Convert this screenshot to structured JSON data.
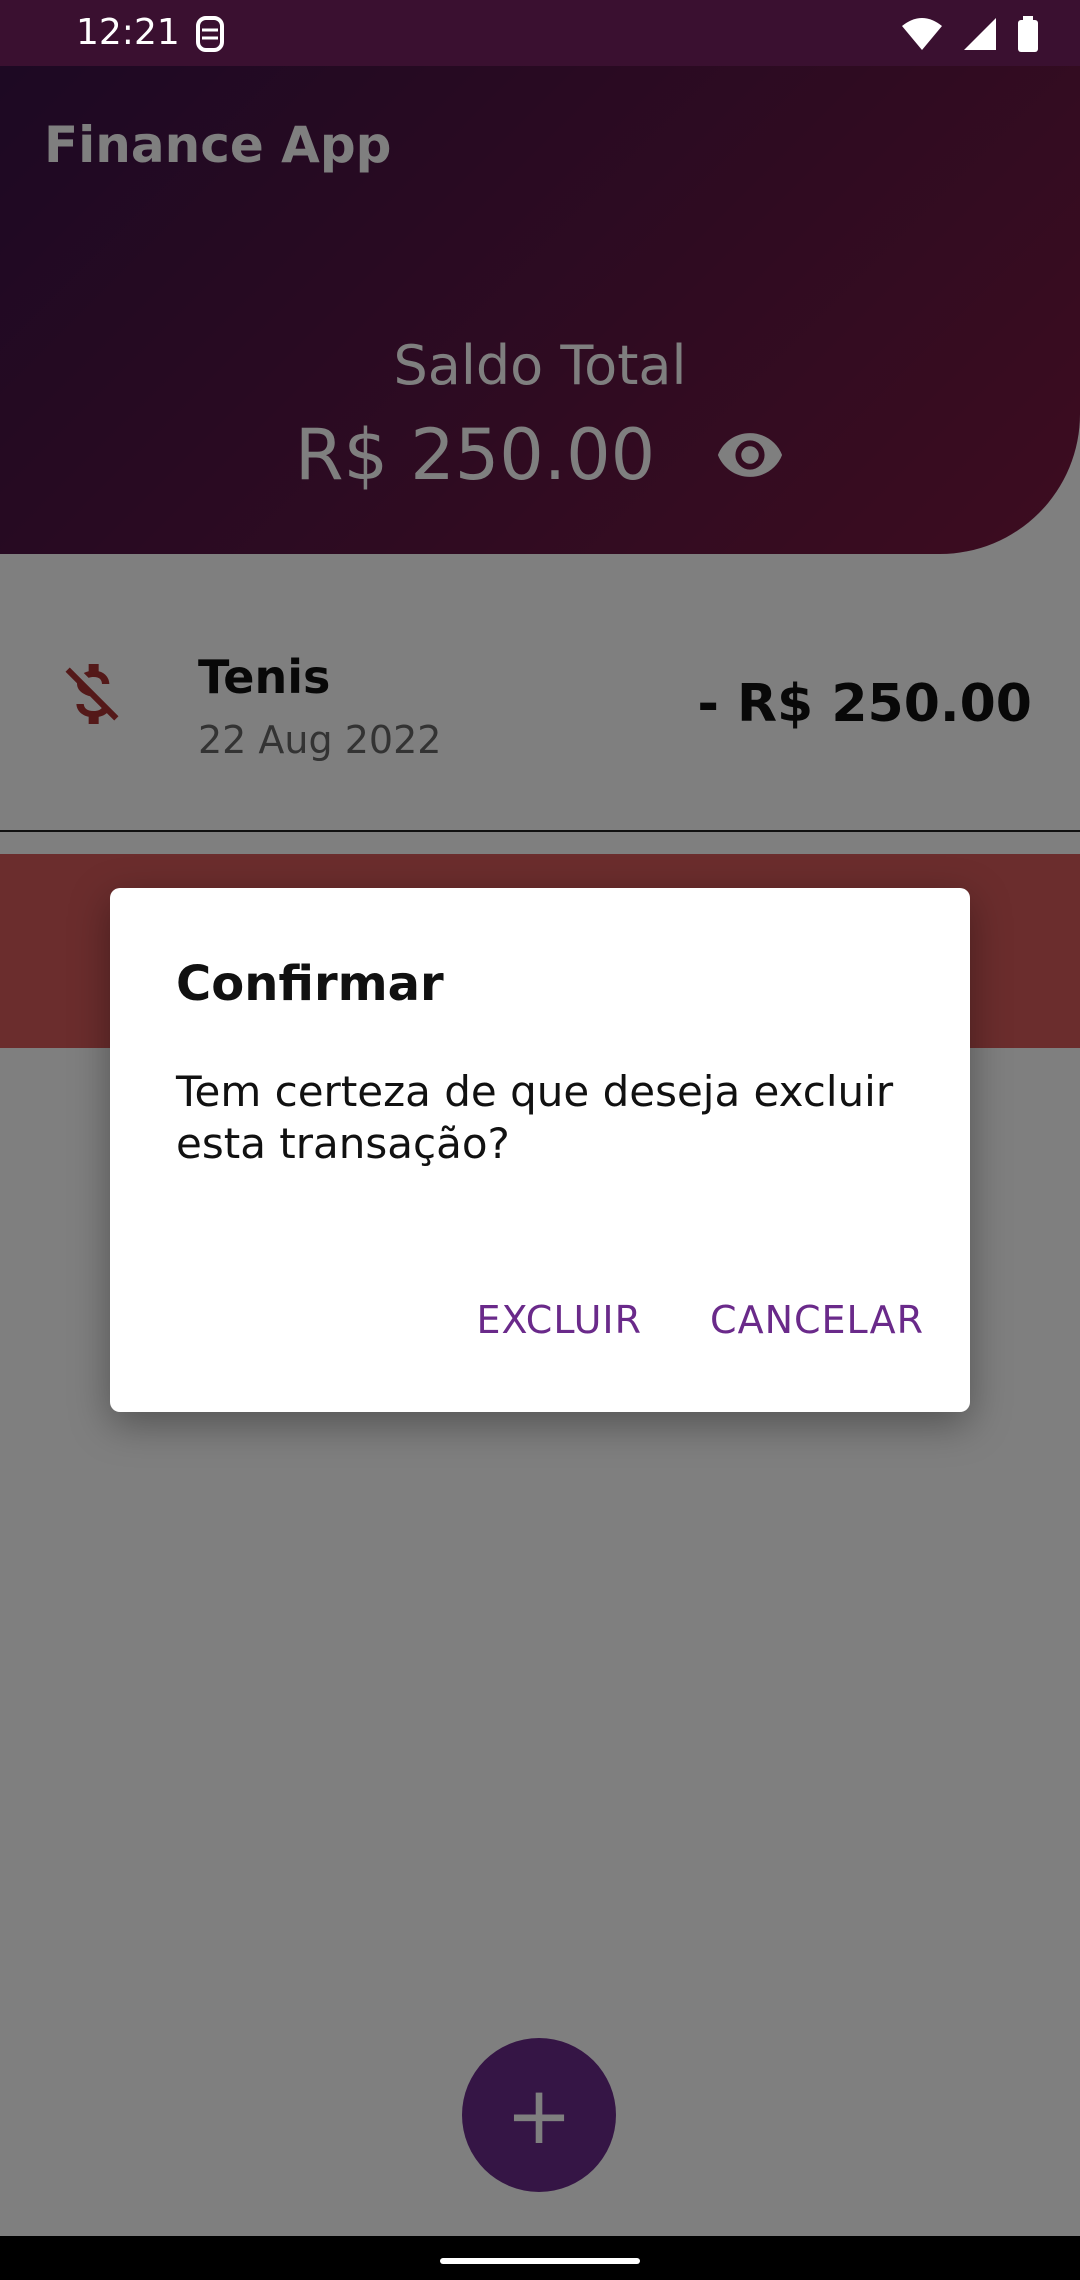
{
  "status_bar": {
    "time": "12:21"
  },
  "header": {
    "app_title": "Finance App",
    "balance_label": "Saldo Total",
    "balance_value": "R$ 250.00"
  },
  "transactions": [
    {
      "title": "Tenis",
      "date": "22 Aug 2022",
      "amount": "- R$ 250.00"
    }
  ],
  "dialog": {
    "title": "Confirmar",
    "message": "Tem certeza de que deseja excluir esta transação?",
    "confirm_label": "EXCLUIR",
    "cancel_label": "CANCELAR"
  },
  "fab": {
    "label": "+"
  },
  "colors": {
    "accent": "#6a2a8a",
    "header_start": "#3a1247",
    "header_end": "#7a1a40",
    "delete_bg": "#d65a5a"
  },
  "icons": {
    "visibility": "eye-icon",
    "transaction": "money-off-icon",
    "add": "plus-icon"
  }
}
